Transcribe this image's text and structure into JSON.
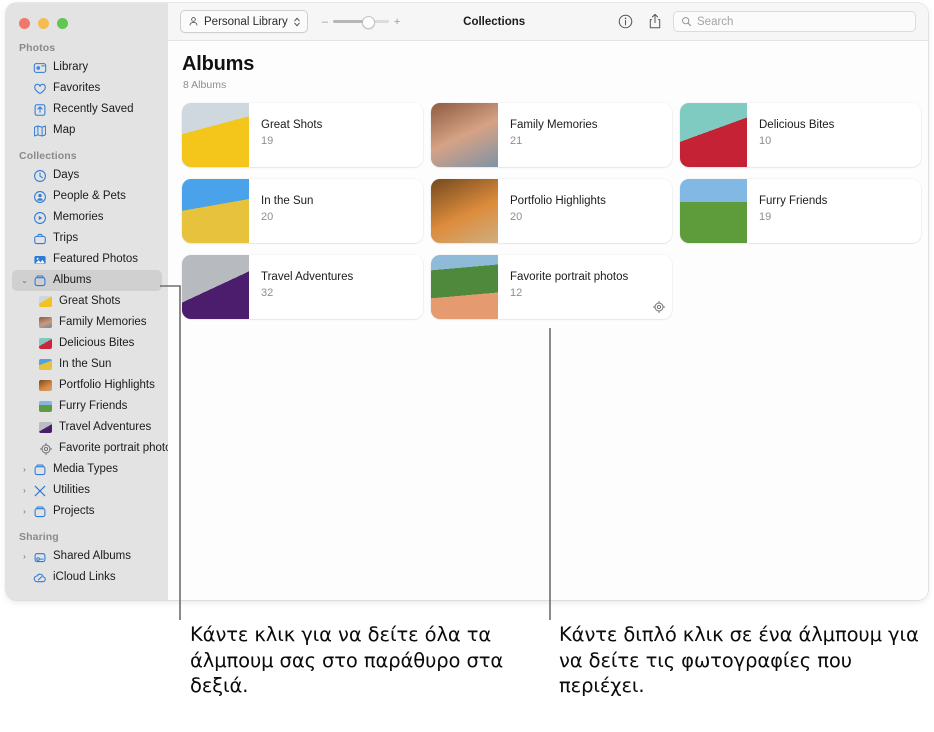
{
  "window": {
    "traffic_lights": [
      "close",
      "minimize",
      "zoom"
    ],
    "traffic_colors": {
      "close": "#f0776c",
      "minimize": "#f5bd4f",
      "zoom": "#62c554"
    }
  },
  "toolbar": {
    "library_button": "Personal Library",
    "library_chevron": "chevron-up-down-icon",
    "zoom_out": "–",
    "zoom_in": "+",
    "title": "Collections",
    "info_icon": "info-circle-icon",
    "share_icon": "share-icon",
    "search": {
      "placeholder": "Search",
      "value": "",
      "icon": "search-icon"
    }
  },
  "sidebar": {
    "sections": [
      {
        "title": "Photos",
        "items": [
          {
            "label": "Library",
            "icon": "photos-library-icon",
            "selected": false,
            "disclosure": "",
            "indent": 0
          },
          {
            "label": "Favorites",
            "icon": "heart-icon",
            "selected": false,
            "disclosure": "",
            "indent": 0
          },
          {
            "label": "Recently Saved",
            "icon": "recently-saved-icon",
            "selected": false,
            "disclosure": "",
            "indent": 0
          },
          {
            "label": "Map",
            "icon": "map-icon",
            "selected": false,
            "disclosure": "",
            "indent": 0
          }
        ]
      },
      {
        "title": "Collections",
        "items": [
          {
            "label": "Days",
            "icon": "clock-icon",
            "selected": false,
            "disclosure": "",
            "indent": 0
          },
          {
            "label": "People & Pets",
            "icon": "person-circle-icon",
            "selected": false,
            "disclosure": "",
            "indent": 0
          },
          {
            "label": "Memories",
            "icon": "memories-play-icon",
            "selected": false,
            "disclosure": "",
            "indent": 0
          },
          {
            "label": "Trips",
            "icon": "trips-icon",
            "selected": false,
            "disclosure": "",
            "indent": 0
          },
          {
            "label": "Featured Photos",
            "icon": "featured-photos-icon",
            "selected": false,
            "disclosure": "",
            "indent": 0
          },
          {
            "label": "Albums",
            "icon": "albums-folder-icon",
            "selected": true,
            "disclosure": "⌄",
            "indent": 0
          },
          {
            "label": "Great Shots",
            "icon": "album-thumb-great-shots",
            "selected": false,
            "disclosure": "",
            "indent": 1
          },
          {
            "label": "Family Memories",
            "icon": "album-thumb-family-memories",
            "selected": false,
            "disclosure": "",
            "indent": 1
          },
          {
            "label": "Delicious Bites",
            "icon": "album-thumb-delicious-bites",
            "selected": false,
            "disclosure": "",
            "indent": 1
          },
          {
            "label": "In the Sun",
            "icon": "album-thumb-in-the-sun",
            "selected": false,
            "disclosure": "",
            "indent": 1
          },
          {
            "label": "Portfolio Highlights",
            "icon": "album-thumb-portfolio-highlights",
            "selected": false,
            "disclosure": "",
            "indent": 1
          },
          {
            "label": "Furry Friends",
            "icon": "album-thumb-furry-friends",
            "selected": false,
            "disclosure": "",
            "indent": 1
          },
          {
            "label": "Travel Adventures",
            "icon": "album-thumb-travel-adventures",
            "selected": false,
            "disclosure": "",
            "indent": 1
          },
          {
            "label": "Favorite portrait photos",
            "icon": "smart-album-gear-icon",
            "selected": false,
            "disclosure": "",
            "indent": 1
          },
          {
            "label": "Media Types",
            "icon": "media-types-folder-icon",
            "selected": false,
            "disclosure": "›",
            "indent": 0
          },
          {
            "label": "Utilities",
            "icon": "utilities-icon",
            "selected": false,
            "disclosure": "›",
            "indent": 0
          },
          {
            "label": "Projects",
            "icon": "projects-folder-icon",
            "selected": false,
            "disclosure": "›",
            "indent": 0
          }
        ]
      },
      {
        "title": "Sharing",
        "items": [
          {
            "label": "Shared Albums",
            "icon": "shared-albums-icon",
            "selected": false,
            "disclosure": "›",
            "indent": 0
          },
          {
            "label": "iCloud Links",
            "icon": "icloud-link-icon",
            "selected": false,
            "disclosure": "",
            "indent": 0
          }
        ]
      }
    ]
  },
  "main": {
    "title": "Albums",
    "subtitle": "8 Albums",
    "albums": [
      {
        "name": "Great Shots",
        "count": "19",
        "badge": ""
      },
      {
        "name": "Family Memories",
        "count": "21",
        "badge": ""
      },
      {
        "name": "Delicious Bites",
        "count": "10",
        "badge": ""
      },
      {
        "name": "In the Sun",
        "count": "20",
        "badge": ""
      },
      {
        "name": "Portfolio Highlights",
        "count": "20",
        "badge": ""
      },
      {
        "name": "Furry Friends",
        "count": "19",
        "badge": ""
      },
      {
        "name": "Travel Adventures",
        "count": "32",
        "badge": ""
      },
      {
        "name": "Favorite portrait photos",
        "count": "12",
        "badge": "smart-album-gear-icon"
      }
    ]
  },
  "callouts": {
    "left": "Κάντε κλικ για να δείτε όλα τα άλμπουμ σας στο παράθυρο στα δεξιά.",
    "right": "Κάντε διπλό κλικ σε ένα άλμπουμ για να δείτε τις φωτογραφίες που περιέχει."
  }
}
